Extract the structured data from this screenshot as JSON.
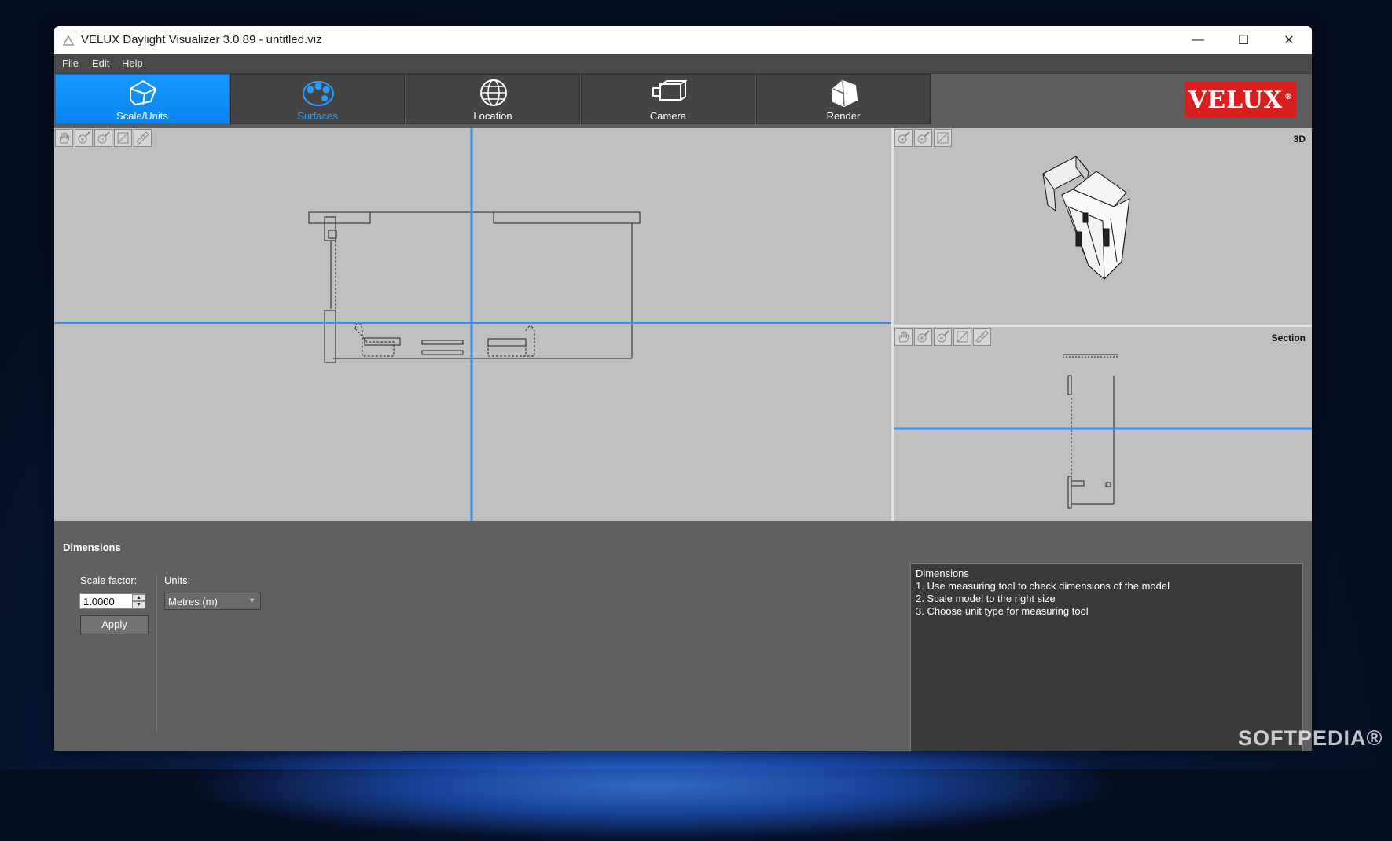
{
  "window": {
    "title": "VELUX Daylight Visualizer 3.0.89 - untitled.viz",
    "controls": {
      "minimize": "—",
      "maximize": "☐",
      "close": "✕"
    }
  },
  "menu": [
    {
      "label": "File"
    },
    {
      "label": "Edit"
    },
    {
      "label": "Help"
    }
  ],
  "tabs": [
    {
      "label": "Scale/Units",
      "icon": "house-outline-icon",
      "active": true
    },
    {
      "label": "Surfaces",
      "icon": "palette-icon",
      "active": false
    },
    {
      "label": "Location",
      "icon": "globe-icon",
      "active": false
    },
    {
      "label": "Camera",
      "icon": "video-camera-icon",
      "active": false
    },
    {
      "label": "Render",
      "icon": "render-house-icon",
      "active": false
    }
  ],
  "brand": {
    "logo_text": "VELUX",
    "logo_mark": "®",
    "color": "#d81e1e"
  },
  "viewports": {
    "plan": {
      "tools": [
        "pan-hand-icon",
        "zoom-in-icon",
        "zoom-out-icon",
        "zoom-extents-icon",
        "measure-ruler-icon"
      ]
    },
    "three_d": {
      "label": "3D",
      "tools": [
        "zoom-in-icon",
        "zoom-out-icon",
        "zoom-extents-icon"
      ]
    },
    "section": {
      "label": "Section",
      "tools": [
        "pan-hand-icon",
        "zoom-in-icon",
        "zoom-out-icon",
        "zoom-extents-icon",
        "measure-ruler-icon"
      ]
    }
  },
  "accent_color": "#3c8ee8",
  "dimensions_panel": {
    "title": "Dimensions",
    "scale_factor_label": "Scale factor:",
    "scale_factor_value": "1.0000",
    "apply_label": "Apply",
    "units_label": "Units:",
    "units_value": "Metres (m)"
  },
  "help": {
    "title": "Dimensions",
    "lines": [
      "1. Use measuring tool to check dimensions of the model",
      "2. Scale model to the right size",
      "3. Choose unit type for measuring tool"
    ]
  },
  "watermark": "SOFTPEDIA®"
}
